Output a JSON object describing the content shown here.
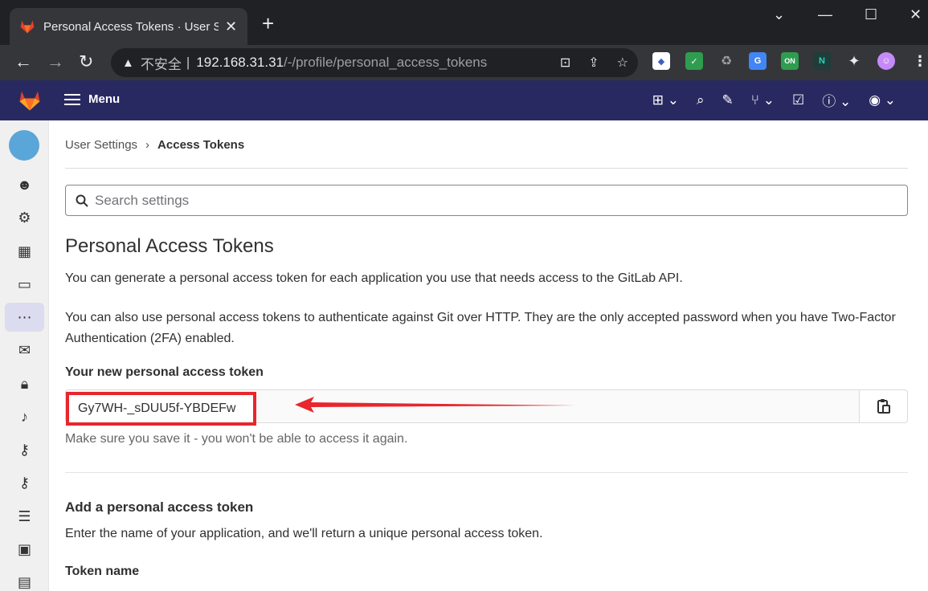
{
  "browser": {
    "tab_title": "Personal Access Tokens · User Settings",
    "tab_close": "✕",
    "new_tab": "+",
    "url_insecure": "不安全",
    "url_separator": "|",
    "url_host": "192.168.31.31",
    "url_path": "/-/profile/personal_access_tokens"
  },
  "gitlab_header": {
    "menu_label": "Menu"
  },
  "breadcrumb": {
    "parent": "User Settings",
    "separator": "›",
    "current": "Access Tokens"
  },
  "search": {
    "placeholder": "Search settings"
  },
  "page": {
    "title": "Personal Access Tokens",
    "intro": "You can generate a personal access token for each application you use that needs access to the GitLab API.",
    "intro2": "You can also use personal access tokens to authenticate against Git over HTTP. They are the only accepted password when you have Two-Factor Authentication (2FA) enabled.",
    "new_token_label": "Your new personal access token",
    "new_token_value": "Gy7WH-_sDUU5f-YBDEFw",
    "save_warning": "Make sure you save it - you won't be able to access it again.",
    "add_heading": "Add a personal access token",
    "add_intro": "Enter the name of your application, and we'll return a unique personal access token.",
    "token_name_label": "Token name"
  },
  "colors": {
    "header_bg": "#292961",
    "highlight_red": "#e8262c"
  }
}
